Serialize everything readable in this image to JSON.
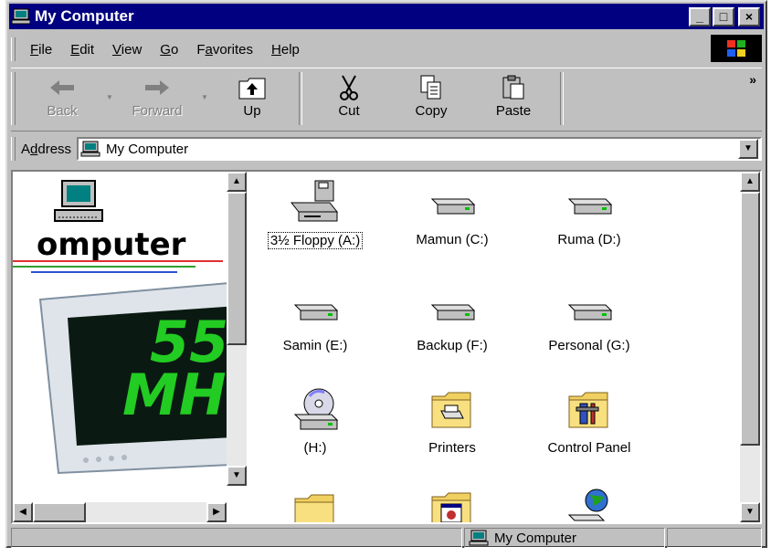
{
  "window": {
    "title": "My Computer",
    "buttons": {
      "minimize": "_",
      "maximize": "□",
      "close": "×"
    }
  },
  "menu": [
    {
      "pre": "",
      "ul": "F",
      "post": "ile"
    },
    {
      "pre": "",
      "ul": "E",
      "post": "dit"
    },
    {
      "pre": "",
      "ul": "V",
      "post": "iew"
    },
    {
      "pre": "",
      "ul": "G",
      "post": "o"
    },
    {
      "pre": "F",
      "ul": "a",
      "post": "vorites"
    },
    {
      "pre": "",
      "ul": "H",
      "post": "elp"
    }
  ],
  "toolbar": {
    "back": "Back",
    "forward": "Forward",
    "up": "Up",
    "cut": "Cut",
    "copy": "Copy",
    "paste": "Paste",
    "more": "»"
  },
  "address": {
    "label_pre": "A",
    "label_ul": "d",
    "label_post": "dress",
    "value": "My Computer"
  },
  "leftpane": {
    "brand": "omputer",
    "monitor_text1": "55",
    "monitor_text2": "MH"
  },
  "items": [
    {
      "label": "3½ Floppy (A:)",
      "icon": "floppy-drive-icon",
      "selected": true
    },
    {
      "label": "Mamun (C:)",
      "icon": "hard-drive-icon"
    },
    {
      "label": "Ruma (D:)",
      "icon": "hard-drive-icon"
    },
    {
      "label": "Samin (E:)",
      "icon": "hard-drive-icon"
    },
    {
      "label": "Backup (F:)",
      "icon": "hard-drive-icon"
    },
    {
      "label": "Personal (G:)",
      "icon": "hard-drive-icon"
    },
    {
      "label": "(H:)",
      "icon": "cd-drive-icon"
    },
    {
      "label": "Printers",
      "icon": "printers-folder-icon"
    },
    {
      "label": "Control Panel",
      "icon": "control-panel-icon"
    }
  ],
  "statusbar": {
    "right": "My Computer"
  },
  "colors": {
    "titlebar": "#000080",
    "chrome": "#c0c0c0",
    "monitor_text": "#22cc22"
  }
}
